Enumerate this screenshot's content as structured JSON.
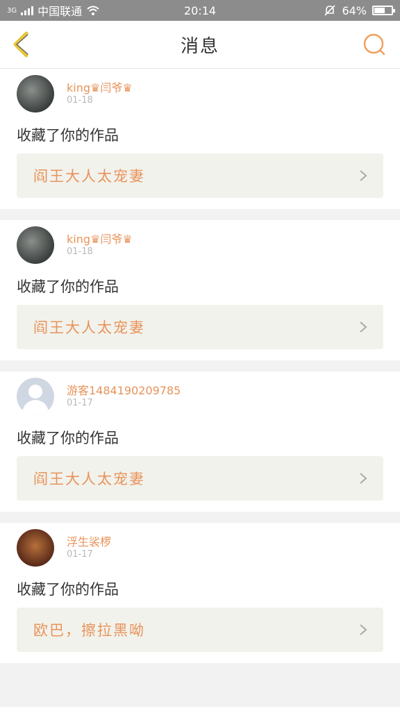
{
  "status_bar": {
    "network": "3G",
    "carrier": "中国联通",
    "time": "20:14",
    "battery": "64%",
    "battery_level": 0.64
  },
  "header": {
    "title": "消息",
    "back_icon": "chevron-left-icon",
    "search_icon": "search-icon"
  },
  "colors": {
    "accent": "#e8935a",
    "back_icon": "#e8c53a",
    "text": "#333333"
  },
  "messages": [
    {
      "username": "king♛闫爷♛",
      "date": "01-18",
      "action": "收藏了你的作品",
      "work_title": "阎王大人太宠妻",
      "avatar": "photo-avatar"
    },
    {
      "username": "king♛闫爷♛",
      "date": "01-18",
      "action": "收藏了你的作品",
      "work_title": "阎王大人太宠妻",
      "avatar": "photo-avatar"
    },
    {
      "username": "游客1484190209785",
      "date": "01-17",
      "action": "收藏了你的作品",
      "work_title": "阎王大人太宠妻",
      "avatar": "default-avatar"
    },
    {
      "username": "浮生裟椤",
      "date": "01-17",
      "action": "收藏了你的作品",
      "work_title": "欧巴，擦拉黑呦",
      "avatar": "photo-avatar"
    }
  ]
}
